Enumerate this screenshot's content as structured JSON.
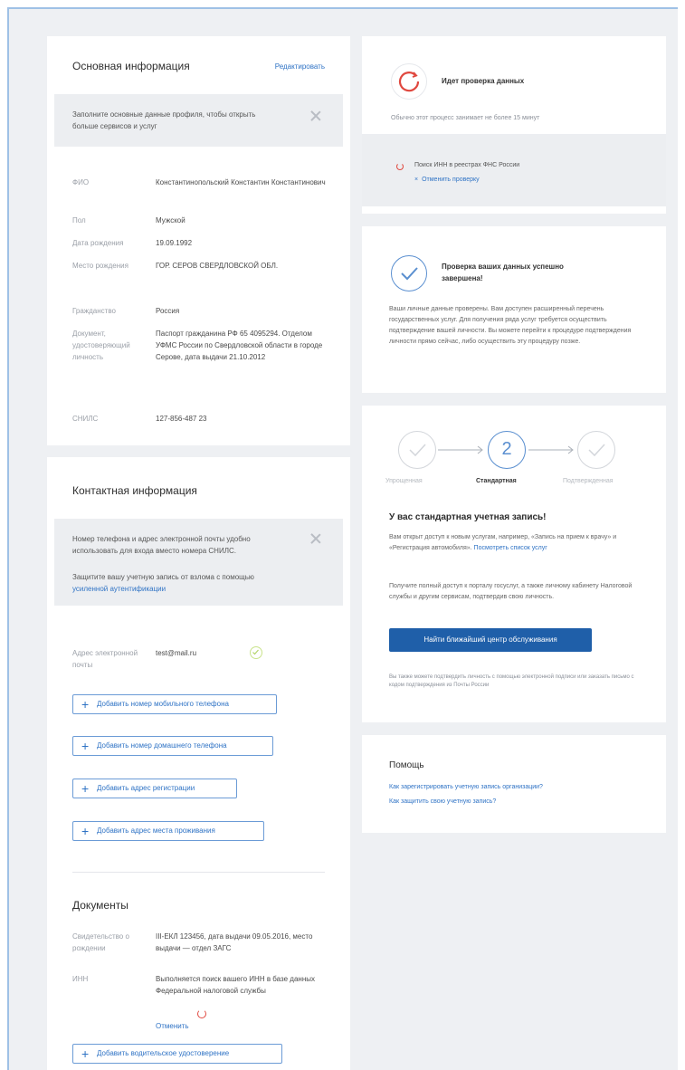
{
  "basic_info": {
    "title": "Основная информация",
    "edit_link": "Редактировать",
    "notice": "Заполните основные данные профиля, чтобы открыть больше сервисов и услуг",
    "rows": [
      {
        "label": "ФИО",
        "value": "Константинопольский Константин Константинович"
      },
      {
        "label": "Пол",
        "value": "Мужской"
      },
      {
        "label": "Дата рождения",
        "value": "19.09.1992"
      },
      {
        "label": "Место рождения",
        "value": "ГОР. СЕРОВ СВЕРДЛОВСКОЙ ОБЛ."
      },
      {
        "label": "Гражданство",
        "value": "Россия"
      },
      {
        "label": "Документ, удостоверяющий личность",
        "value": "Паспорт гражданина РФ 65 4095294. Отделом УФМС России по Свердловской области в городе Серове, дата выдачи 21.10.2012"
      },
      {
        "label": "СНИЛС",
        "value": "127-856-487 23"
      }
    ]
  },
  "contact_info": {
    "title": "Контактная информация",
    "notice_line1": "Номер телефона и адрес электронной почты удобно использовать для входа вместо номера СНИЛС.",
    "notice_line2": "Защитите вашу учетную запись от взлома с помощью",
    "notice_link": "усиленной аутентификации",
    "email_label": "Адрес электронной почты",
    "email_value": "test@mail.ru",
    "buttons": [
      "Добавить номер мобильного телефона",
      "Добавить номер домашнего телефона",
      "Добавить адрес регистрации",
      "Добавить адрес места проживания"
    ]
  },
  "documents": {
    "title": "Документы",
    "rows": [
      {
        "label": "Свидетельство о рождении",
        "value": "III-ЕКЛ 123456, дата выдачи 09.05.2016, место выдачи — отдел ЗАГС"
      },
      {
        "label": "ИНН",
        "value": "Выполняется поиск вашего ИНН в базе данных Федеральной налоговой службы"
      }
    ],
    "cancel_link": "Отменить",
    "add_button": "Добавить водительское удостоверение"
  },
  "verifying": {
    "title": "Идет проверка данных",
    "subtitle": "Обычно этот процесс занимает не более 15 минут",
    "item": "Поиск ИНН в реестрах ФНС России",
    "cancel": "Отменить проверку"
  },
  "verified": {
    "title": "Проверка ваших данных успешно завершена!",
    "text": "Ваши личные данные проверены. Вам доступен расширенный перечень государственных услуг. Для получения ряда услуг требуется осуществить подтверждение вашей личности. Вы можете перейти к процедуре подтверждения личности прямо сейчас, либо осуществить эту процедуру позже."
  },
  "account": {
    "steps": [
      {
        "label": "Упрощенная"
      },
      {
        "label": "Стандартная",
        "number": "2"
      },
      {
        "label": "Подтвержденная"
      }
    ],
    "title": "У вас стандартная учетная запись!",
    "text1": "Вам открыт доступ к новым услугам, например, «Запись на прием к врачу» и «Регистрация автомобиля».",
    "text1_link": "Посмотреть список услуг",
    "text2": "Получите полный доступ к порталу госуслуг, а также личному кабинету Налоговой службы и другим сервисам, подтвердив свою личность.",
    "button": "Найти ближайший центр обслуживания",
    "footnote": "Вы также можете подтвердить личность с помощью электронной подписи или заказать письмо с кодом подтверждения из Почты России"
  },
  "help": {
    "title": "Помощь",
    "links": [
      "Как зарегистрировать учетную запись организации?",
      "Как защитить свою учетную запись?"
    ]
  },
  "colors": {
    "accent": "#2f73c5",
    "primary_button": "#1f5fa9",
    "progress_red": "#e0483f",
    "success_blue": "#5a8fd0",
    "verified_green": "#c9e38b"
  }
}
